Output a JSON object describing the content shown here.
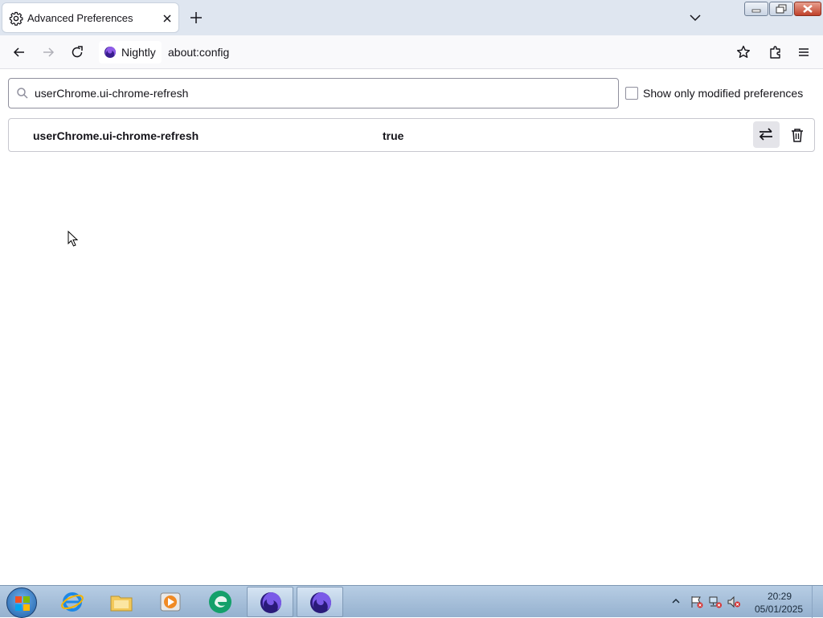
{
  "tab": {
    "title": "Advanced Preferences",
    "icon": "gear-icon"
  },
  "window_controls": [
    "minimize-icon",
    "restore-icon",
    "close-icon"
  ],
  "navbar": {
    "identity_label": "Nightly",
    "url": "about:config"
  },
  "search": {
    "value": "userChrome.ui-chrome-refresh",
    "icon": "search-icon"
  },
  "filter": {
    "label": "Show only modified preferences",
    "checked": false
  },
  "preferences": [
    {
      "name": "userChrome.ui-chrome-refresh",
      "value": "true"
    }
  ],
  "taskbar": {
    "apps": [
      "internet-explorer-icon",
      "file-explorer-icon",
      "media-player-icon",
      "edge-icon",
      "firefox-nightly-icon",
      "firefox-nightly-icon"
    ],
    "clock": {
      "time": "20:29",
      "date": "05/01/2025"
    }
  },
  "colors": {
    "tabstrip": "#dfe6f0",
    "toggle_bg": "#e4e4e9",
    "taskbar": "#a9c2dd"
  }
}
